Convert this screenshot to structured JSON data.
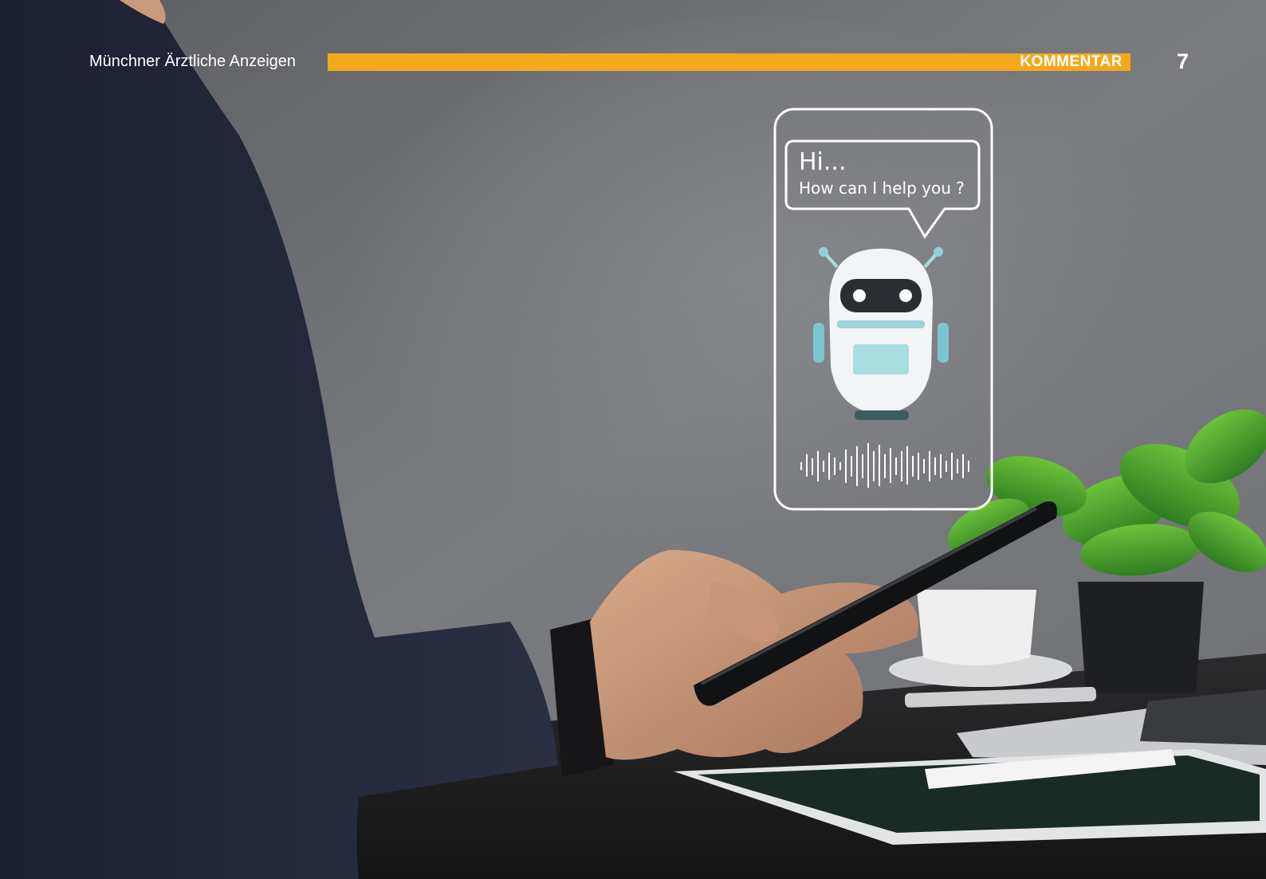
{
  "header": {
    "publication": "Münchner Ärztliche Anzeigen",
    "section": "KOMMENTAR",
    "page_number": "7",
    "accent_color": "#f5a81c"
  },
  "photo": {
    "chat_bubble": {
      "greeting": "Hi...",
      "question": "How can I help you ?"
    },
    "robot_icon": "chatbot-robot-icon",
    "waveform_icon": "voice-waveform-icon"
  }
}
